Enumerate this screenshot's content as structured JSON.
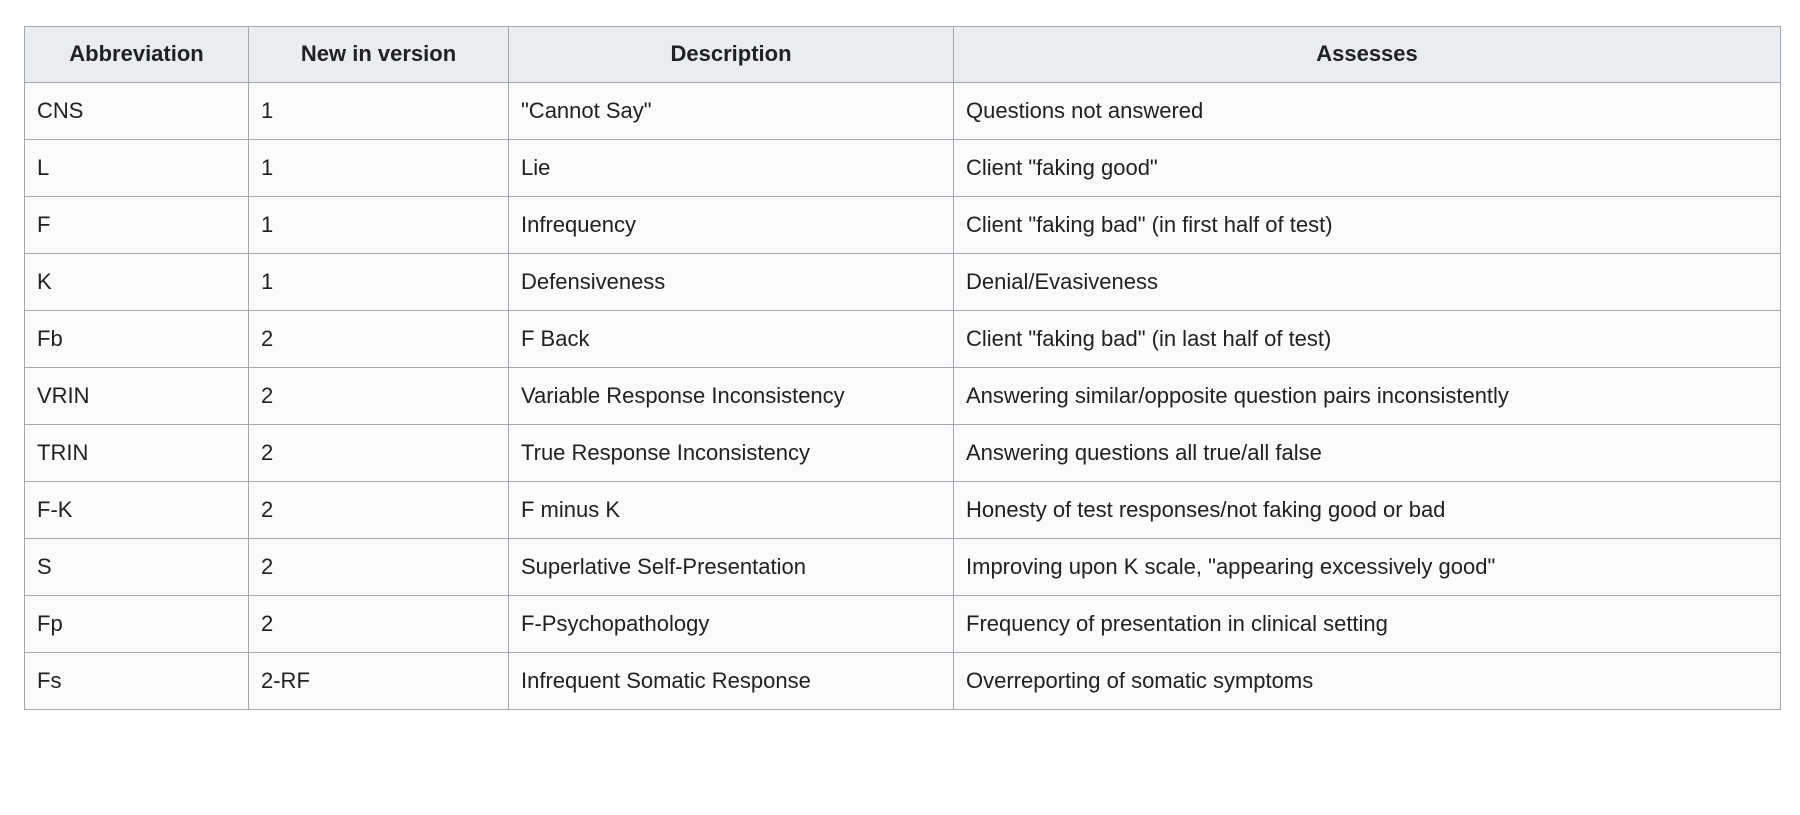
{
  "table": {
    "name": "MMPI validity scales table",
    "columns": [
      {
        "key": "abbreviation",
        "label": "Abbreviation",
        "align": "center"
      },
      {
        "key": "version",
        "label": "New in version",
        "align": "center"
      },
      {
        "key": "description",
        "label": "Description",
        "align": "center"
      },
      {
        "key": "assesses",
        "label": "Assesses",
        "align": "center"
      }
    ],
    "rows": [
      {
        "abbreviation": "CNS",
        "version": "1",
        "description": "\"Cannot Say\"",
        "assesses": "Questions not answered"
      },
      {
        "abbreviation": "L",
        "version": "1",
        "description": "Lie",
        "assesses": "Client \"faking good\""
      },
      {
        "abbreviation": "F",
        "version": "1",
        "description": "Infrequency",
        "assesses": "Client \"faking bad\" (in first half of test)"
      },
      {
        "abbreviation": "K",
        "version": "1",
        "description": "Defensiveness",
        "assesses": "Denial/Evasiveness"
      },
      {
        "abbreviation": "Fb",
        "version": "2",
        "description": "F Back",
        "assesses": "Client \"faking bad\" (in last half of test)"
      },
      {
        "abbreviation": "VRIN",
        "version": "2",
        "description": "Variable Response Inconsistency",
        "assesses": "Answering similar/opposite question pairs inconsistently"
      },
      {
        "abbreviation": "TRIN",
        "version": "2",
        "description": "True Response Inconsistency",
        "assesses": "Answering questions all true/all false"
      },
      {
        "abbreviation": "F-K",
        "version": "2",
        "description": "F minus K",
        "assesses": "Honesty of test responses/not faking good or bad"
      },
      {
        "abbreviation": "S",
        "version": "2",
        "description": "Superlative Self-Presentation",
        "assesses": "Improving upon K scale, \"appearing excessively good\""
      },
      {
        "abbreviation": "Fp",
        "version": "2",
        "description": "F-Psychopathology",
        "assesses": "Frequency of presentation in clinical setting"
      },
      {
        "abbreviation": "Fs",
        "version": "2-RF",
        "description": "Infrequent Somatic Response",
        "assesses": "Overreporting of somatic symptoms"
      }
    ]
  },
  "style": {
    "header_background": "#eaecf0",
    "cell_background": "#fbfbfc",
    "border_color": "#a2a9b1",
    "text_color": "#202122",
    "page_background": "#ffffff"
  }
}
